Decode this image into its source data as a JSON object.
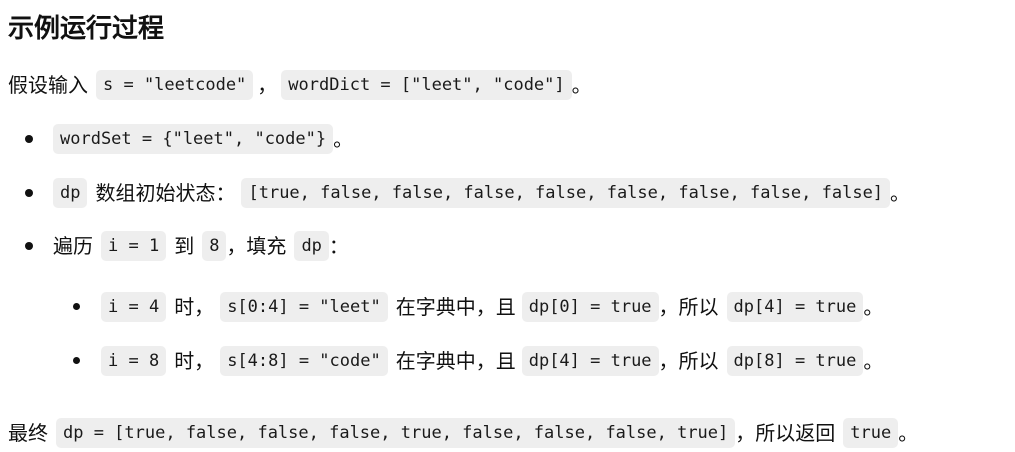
{
  "heading": "示例运行过程",
  "intro": {
    "prefix": "假设输入",
    "code_s": "s = \"leetcode\"",
    "sep": "，",
    "code_dict": "wordDict = [\"leet\", \"code\"]",
    "end": "。"
  },
  "items": [
    {
      "code": "wordSet = {\"leet\", \"code\"}",
      "end": "。"
    },
    {
      "code_dp": "dp",
      "text": "数组初始状态：",
      "code_init": "[true, false, false, false, false, false, false, false, false]",
      "end": "。"
    },
    {
      "text1": "遍历",
      "code_i": "i = 1",
      "text2": "到",
      "code_8": "8",
      "text3": "，填充",
      "code_dp": "dp",
      "end": "："
    }
  ],
  "subitems": [
    {
      "code_i": "i = 4",
      "t1": "时，",
      "code_s": "s[0:4] = \"leet\"",
      "t2": "在字典中，且",
      "code_dp_prev": "dp[0] = true",
      "t3": "，所以",
      "code_dp_set": "dp[4] = true",
      "end": "。"
    },
    {
      "code_i": "i = 8",
      "t1": "时，",
      "code_s": "s[4:8] = \"code\"",
      "t2": "在字典中，且",
      "code_dp_prev": "dp[4] = true",
      "t3": "，所以",
      "code_dp_set": "dp[8] = true",
      "end": "。"
    }
  ],
  "final": {
    "prefix": "最终",
    "code_dp": "dp = [true, false, false, false, true, false, false, false, true]",
    "text": "，所以返回",
    "code_true": "true",
    "end": "。"
  }
}
